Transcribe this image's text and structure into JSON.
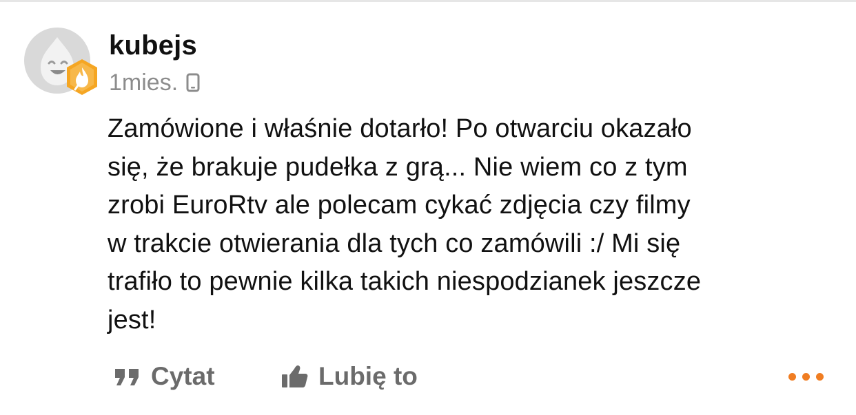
{
  "post": {
    "username": "kubejs",
    "time_ago": "1mies.",
    "device_icon": "phone-icon",
    "avatar_icon": "droplet-mascot-avatar",
    "badge_icon": "hexagon-flame-badge",
    "content": "Zamówione i właśnie dotarło! Po otwarciu okazało\nsię, że brakuje pudełka z grą... Nie wiem co z tym\nzrobi EuroRtv ale polecam cykać zdjęcia czy filmy\nw trakcie otwierania dla tych co zamówili :/ Mi się\ntrafiło to pewnie kilka takich niespodzianek jeszcze\njest!"
  },
  "actions": {
    "quote_label": "Cytat",
    "quote_icon": "quote-icon",
    "like_label": "Lubię to",
    "like_icon": "thumbs-up-icon",
    "more_icon": "more-dots-icon"
  },
  "colors": {
    "accent": "#f07d22",
    "muted_text": "#8c8c8c",
    "action_text": "#6b6b6b",
    "avatar_bg": "#d9d9d9",
    "badge_fill": "#f5a623"
  }
}
